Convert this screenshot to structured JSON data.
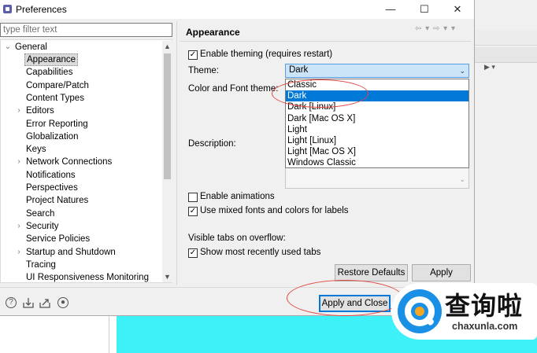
{
  "window": {
    "title": "Preferences",
    "minimize": "—",
    "maximize": "☐",
    "close": "✕"
  },
  "filter": {
    "placeholder": "type filter text",
    "value": ""
  },
  "tree": {
    "root": "General",
    "items": [
      "Appearance",
      "Capabilities",
      "Compare/Patch",
      "Content Types",
      "Editors",
      "Error Reporting",
      "Globalization",
      "Keys",
      "Network Connections",
      "Notifications",
      "Perspectives",
      "Project Natures",
      "Search",
      "Security",
      "Service Policies",
      "Startup and Shutdown",
      "Tracing",
      "UI Responsiveness Monitoring"
    ]
  },
  "page": {
    "title": "Appearance",
    "nav_back": "⇦ ▾",
    "nav_forward": "⇨ ▾",
    "nav_menu": "▾"
  },
  "form": {
    "enable_theming": {
      "label": "Enable theming (requires restart)",
      "checked": true
    },
    "theme_label": "Theme:",
    "theme_value": "Dark",
    "color_font_label": "Color and Font theme:",
    "description_label": "Description:",
    "theme_options": [
      "Classic",
      "Dark",
      "Dark [Linux]",
      "Dark [Mac OS X]",
      "Light",
      "Light [Linux]",
      "Light [Mac OS X]",
      "Windows Classic"
    ],
    "selected_option": "Dark",
    "enable_animations": {
      "label": "Enable animations",
      "checked": false
    },
    "mixed_fonts": {
      "label": "Use mixed fonts and colors for labels",
      "checked": true
    },
    "visible_tabs_label": "Visible tabs on overflow:",
    "show_recent_tabs": {
      "label": "Show most recently used tabs",
      "checked": true
    }
  },
  "buttons": {
    "restore_defaults": "Restore Defaults",
    "apply": "Apply",
    "apply_and_close": "Apply and Close"
  },
  "footer_icons": [
    "help-icon",
    "import-icon",
    "export-icon",
    "preferences-record-icon"
  ],
  "watermark": {
    "cn": "查询啦",
    "en": "chaxunla.com"
  },
  "colors": {
    "selection": "#0078d7",
    "combo_bg": "#cce4f7",
    "annotation": "#e2453f",
    "brand_blue": "#1a8fe6",
    "background_cyan": "#3ef0f7"
  }
}
